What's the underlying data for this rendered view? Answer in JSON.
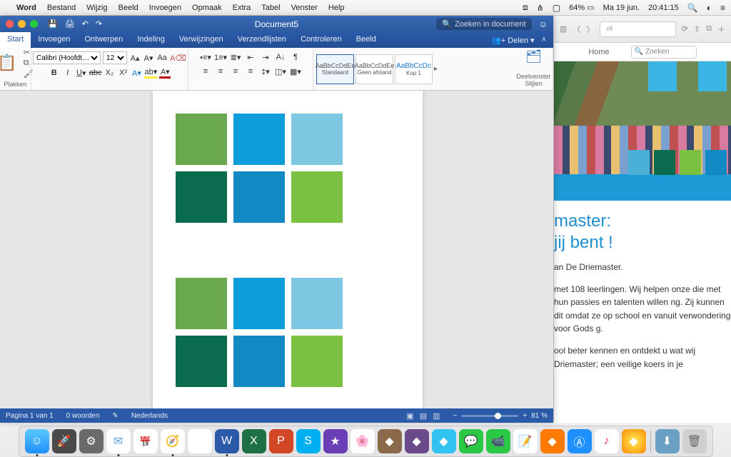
{
  "menubar": {
    "app": "Word",
    "items": [
      "Bestand",
      "Wijzig",
      "Beeld",
      "Invoegen",
      "Opmaak",
      "Extra",
      "Tabel",
      "Venster",
      "Help"
    ],
    "battery": "64%",
    "date": "Ma 19 jun.",
    "time": "20:41:15"
  },
  "word": {
    "title": "Document5",
    "search_placeholder": "Zoeken in document",
    "tabs": [
      "Start",
      "Invoegen",
      "Ontwerpen",
      "Indeling",
      "Verwijzingen",
      "Verzendlijsten",
      "Controleren",
      "Beeld"
    ],
    "share": "Delen",
    "paste_label": "Plakken",
    "font_name": "Calibri (Hoofdt…",
    "font_size": "12",
    "styles": {
      "sample": "AaBbCcDdEe",
      "sample_h": "AaBbCcDc",
      "s1": "Standaard",
      "s2": "Geen afstand",
      "s3": "Kop 1"
    },
    "stylepane": "Deelvenster Stijlen",
    "status": {
      "page": "Pagina 1 van 1",
      "words": "0 woorden",
      "lang": "Nederlands",
      "zoom": "81 %"
    }
  },
  "safari": {
    "addr_suffix": ".nl",
    "tab_home": "Home",
    "search_placeholder": "Zoeken",
    "heading_l1": "master:",
    "heading_l2": "jij bent !",
    "p1": "an De Driemaster.",
    "p2": "met 108 leerlingen. Wij helpen onze die met hun passies en talenten willen ng. Zij kunnen dit omdat ze op school en vanuit verwondering voor Gods g.",
    "p3": "ool beter kennen en ontdekt u wat wij Driemaster; een veilige koers in je"
  },
  "dock": {
    "date_day": "19"
  }
}
